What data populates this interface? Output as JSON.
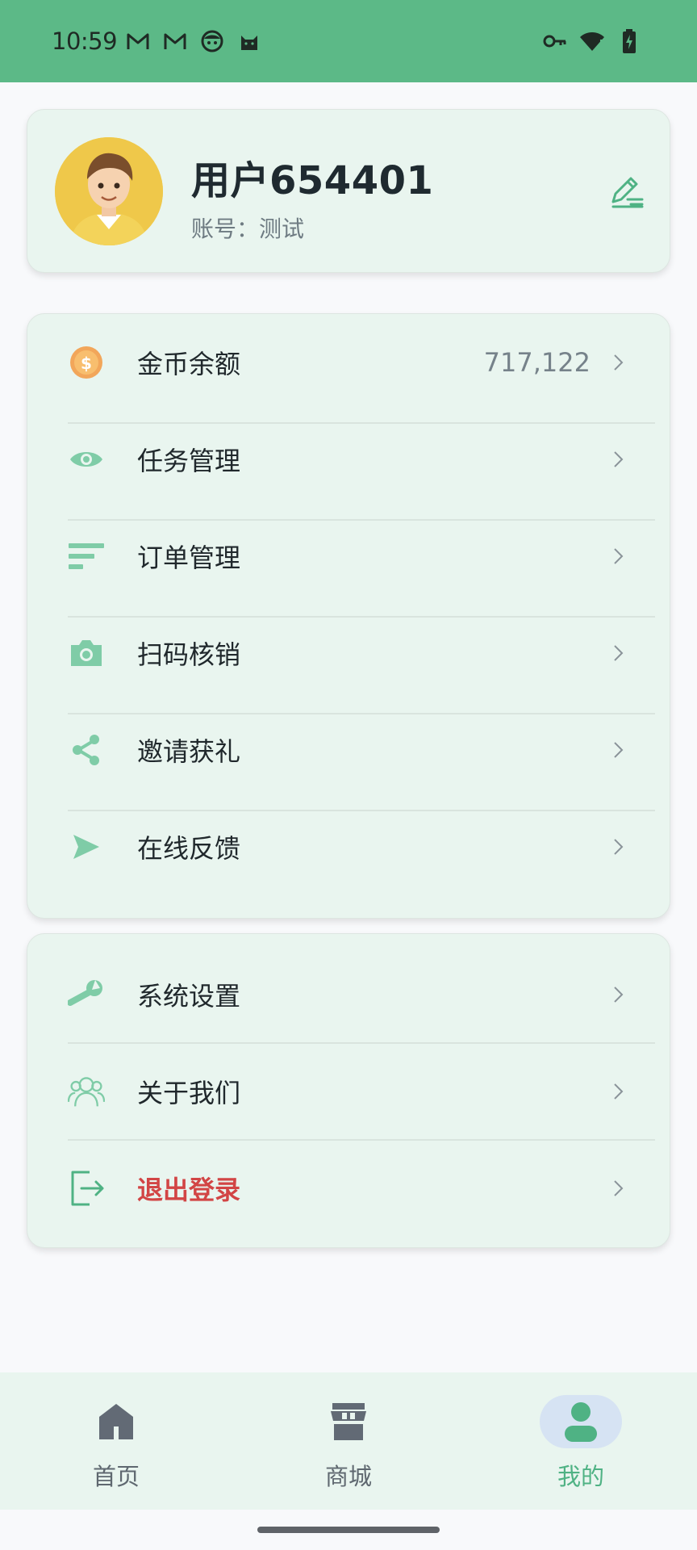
{
  "status_bar": {
    "time": "10:59",
    "left_icons": [
      "gmail-icon",
      "gmail-icon",
      "face-icon",
      "cat-icon"
    ],
    "right_icons": [
      "key-icon",
      "wifi-icon",
      "battery-charging-icon"
    ]
  },
  "profile": {
    "name": "用户654401",
    "account": "账号：测试",
    "avatar_icon": "user-avatar",
    "edit_icon": "edit-icon"
  },
  "menu_primary": [
    {
      "icon": "coin-icon",
      "label": "金币余额",
      "value": "717,122"
    },
    {
      "icon": "eye-icon",
      "label": "任务管理",
      "value": ""
    },
    {
      "icon": "list-icon",
      "label": "订单管理",
      "value": ""
    },
    {
      "icon": "camera-icon",
      "label": "扫码核销",
      "value": ""
    },
    {
      "icon": "share-icon",
      "label": "邀请获礼",
      "value": ""
    },
    {
      "icon": "send-icon",
      "label": "在线反馈",
      "value": ""
    }
  ],
  "menu_secondary": [
    {
      "icon": "wrench-icon",
      "label": "系统设置"
    },
    {
      "icon": "group-icon",
      "label": "关于我们"
    },
    {
      "icon": "logout-icon",
      "label": "退出登录"
    }
  ],
  "bottom_nav": [
    {
      "icon": "home-icon",
      "label": "首页",
      "active": false
    },
    {
      "icon": "store-icon",
      "label": "商城",
      "active": false
    },
    {
      "icon": "person-icon",
      "label": "我的",
      "active": true
    }
  ],
  "colors": {
    "status_bar": "#5cb987",
    "card_bg": "#e9f5ef",
    "accent": "#4fb284",
    "icon_green": "#7fcca7",
    "danger": "#d24545"
  }
}
